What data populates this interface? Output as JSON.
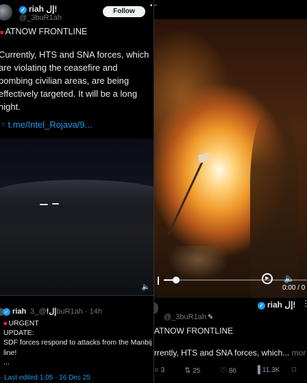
{
  "left_post": {
    "author_name": "riah إل!",
    "author_handle": "@_3buR1ah",
    "follow_label": "Follow",
    "title": "ATNOW FRONTLINE",
    "body": "Currently, HTS and SNA forces, which are violating the ceasefire and bombing civilian areas, are being effectively targeted. It will be a long night.",
    "link": "t.me/Intel_Rojava/9...",
    "reply": {
      "author_name": "riah إل!",
      "author_handle": "@_3buR1ah",
      "time": "14h",
      "line1": "URGENT",
      "line2": "UPDATE:",
      "line3": "SDF forces respond to attacks from the Manbij line!",
      "line4": "...",
      "edited": "Last edited 1:05 · 16 Dec 25"
    }
  },
  "right_post": {
    "author_name": "riah إل!",
    "author_handle": "@_3buR1ah",
    "title": "ATNOW FRONTLINE",
    "body_preview": "rrently, HTS and SNA forces, which...",
    "more_label": "mor",
    "video_time": "0:00 / 0",
    "stats": {
      "replies": "3",
      "reposts": "25",
      "likes": "86",
      "views": "11.3K"
    }
  },
  "icons": {
    "verified": "verified-badge-icon",
    "siren": "siren-emoji-icon",
    "point": "pointing-hand-emoji-icon",
    "volume": "volume-icon",
    "replay": "replay-icon",
    "reply": "reply-icon",
    "repost": "repost-icon",
    "like": "heart-icon",
    "views": "views-icon",
    "bookmark": "bookmark-icon"
  },
  "colors": {
    "link": "#1d9bf0",
    "muted": "#71767b",
    "background": "#000000",
    "text": "#e7e9ea"
  }
}
